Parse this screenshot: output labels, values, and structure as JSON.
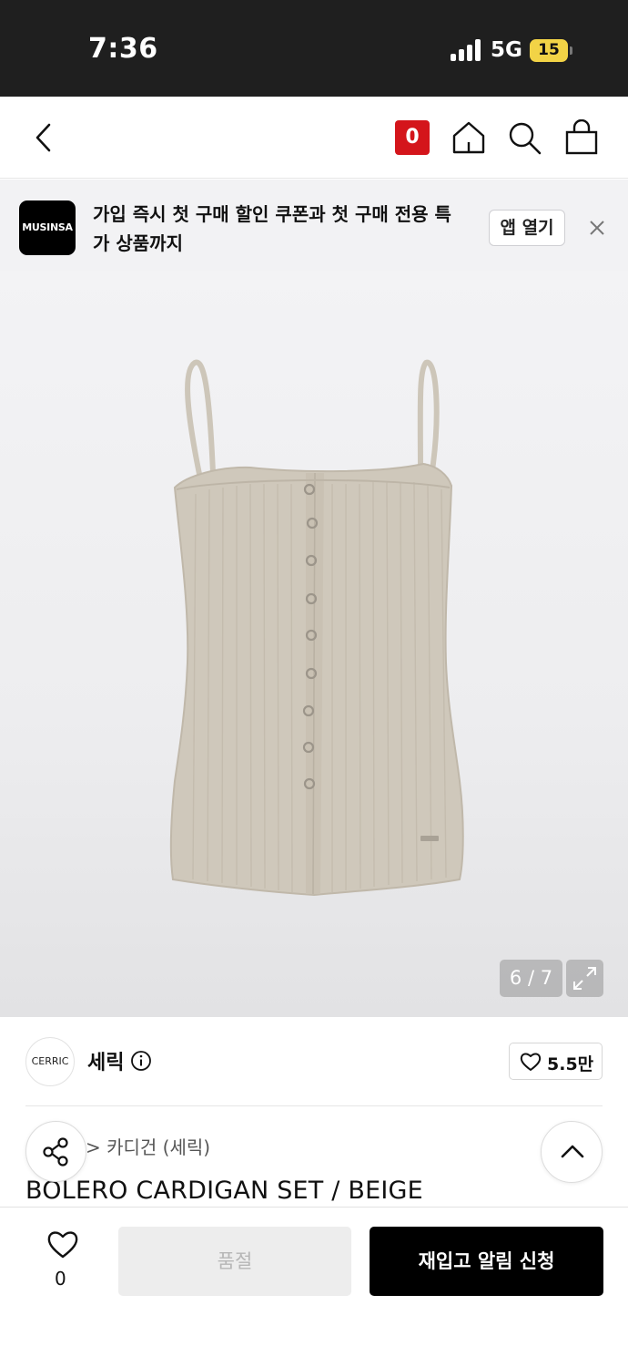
{
  "status_bar": {
    "time": "7:36",
    "network": "5G",
    "battery": "15"
  },
  "nav": {
    "cart_count": "0",
    "icons": [
      "back-icon",
      "home-icon",
      "search-icon",
      "bag-icon"
    ]
  },
  "banner": {
    "logo_text": "MUSINSA",
    "message": "가입 즉시 첫 구매 할인 쿠폰과 첫 구매 전용 특가 상품까지",
    "open_app_label": "앱 열기",
    "close_icon": "close-icon"
  },
  "gallery": {
    "counter": "6 / 7",
    "expand_icon": "expand-icon",
    "garment_color": "#cfc8bb"
  },
  "brand": {
    "logo_text": "CERRIC",
    "name": "세릭",
    "likes": "5.5만"
  },
  "product": {
    "breadcrumb": "> 카디건 (세릭)",
    "title": "BOLERO CARDIGAN SET / BEIGE"
  },
  "actions": {
    "wish_count": "0",
    "soldout_label": "품절",
    "restock_label": "재입고 알림 신청"
  },
  "colors": {
    "accent_red": "#d4151b",
    "primary_black": "#000000"
  }
}
